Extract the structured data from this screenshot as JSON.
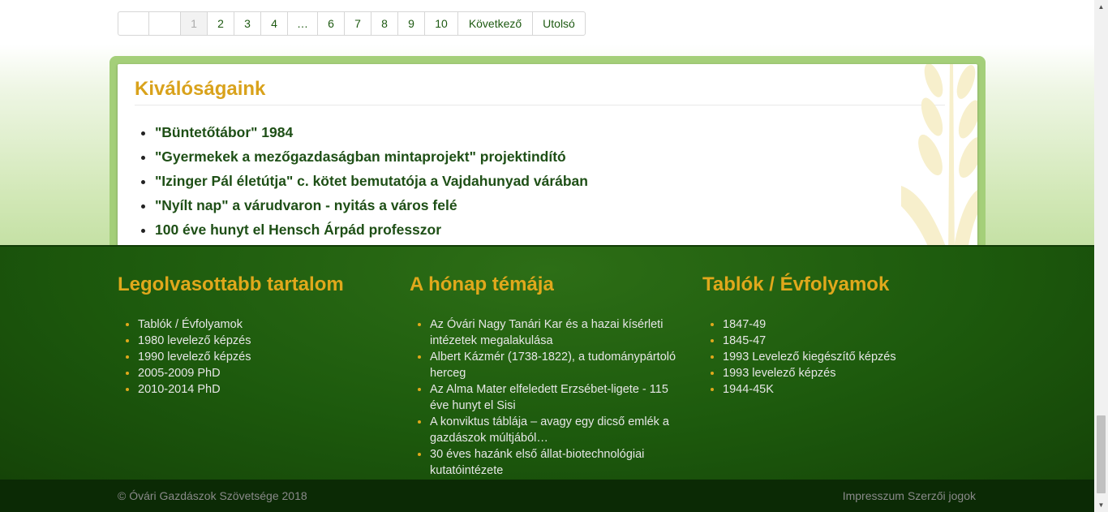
{
  "pagination": {
    "pages": [
      {
        "label": "",
        "w": 38
      },
      {
        "label": "",
        "w": 39
      },
      {
        "label": "1",
        "w": 33,
        "current": true
      },
      {
        "label": "2",
        "w": 33
      },
      {
        "label": "3",
        "w": 33
      },
      {
        "label": "4",
        "w": 33
      },
      {
        "label": "…",
        "w": 37
      },
      {
        "label": "6",
        "w": 33
      },
      {
        "label": "7",
        "w": 33
      },
      {
        "label": "8",
        "w": 33
      },
      {
        "label": "9",
        "w": 33
      },
      {
        "label": "10",
        "w": 41
      },
      {
        "label": "Következő",
        "w": 92
      },
      {
        "label": "Utolsó",
        "w": 64
      }
    ]
  },
  "excellence": {
    "title": "Kiválóságaink",
    "items": [
      "\"Büntetőtábor\" 1984",
      "\"Gyermekek a mezőgazdaságban mintaprojekt\" projektindító",
      "\"Izinger Pál életútja\" c. kötet bemutatója a Vajdahunyad várában",
      "\"Nyílt nap\" a várudvaron - nyitás a város felé",
      "100 éve hunyt el Hensch Árpád professzor"
    ]
  },
  "footer": {
    "columns": [
      {
        "title": "Legolvasottabb tartalom",
        "items": [
          "Tablók / Évfolyamok",
          "1980 levelező képzés",
          "1990 levelező képzés",
          "2005-2009 PhD",
          "2010-2014 PhD"
        ]
      },
      {
        "title": "A hónap témája",
        "items": [
          "Az Óvári Nagy Tanári Kar és a hazai kísérleti intézetek megalakulása",
          "Albert Kázmér (1738-1822), a tudománypártoló herceg",
          "Az Alma Mater elfeledett Erzsébet-ligete - 115 éve hunyt el Sisi",
          "A konviktus táblája – avagy egy dicső emlék a gazdászok múltjából…",
          "30 éves hazánk első állat-biotechnológiai kutatóintézete"
        ]
      },
      {
        "title": "Tablók / Évfolyamok",
        "items": [
          "1847-49",
          "1845-47",
          "1993 Levelező kiegészítő képzés",
          "1993 levelező képzés",
          "1944-45K"
        ]
      }
    ],
    "copyright": "© Óvári Gazdászok Szövetsége 2018",
    "links": [
      "Impresszum",
      "Szerzői jogok"
    ]
  },
  "colors": {
    "accent_gold": "#e0a81c",
    "link_green": "#1e4f16",
    "footer_green": "#1d5a0d"
  }
}
